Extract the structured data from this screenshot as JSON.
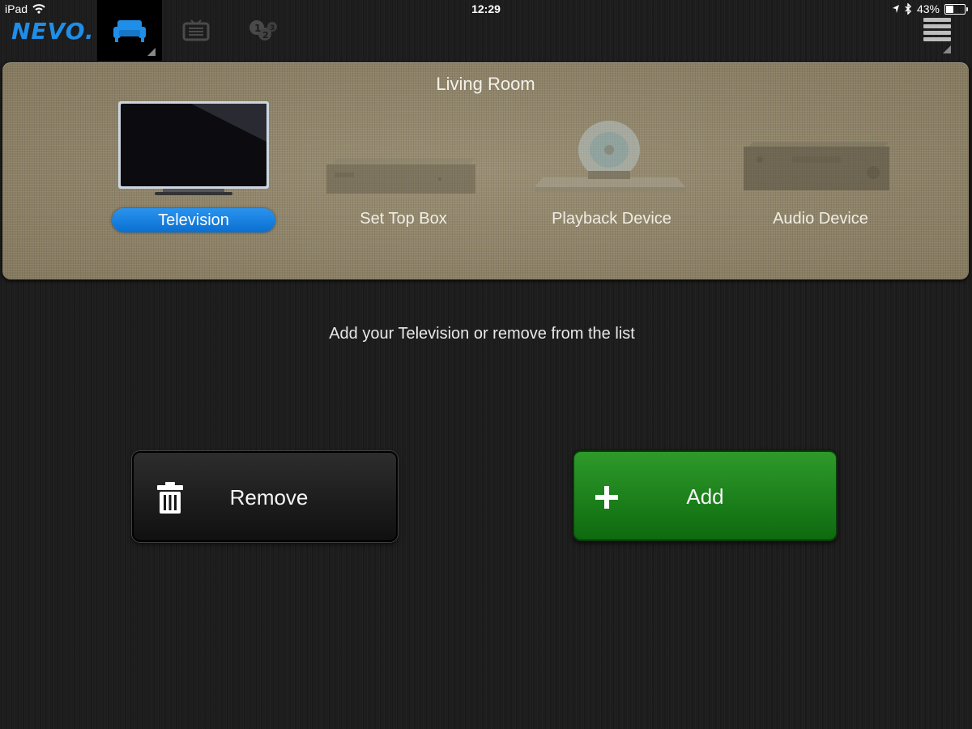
{
  "status_bar": {
    "device": "iPad",
    "time": "12:29",
    "battery": "43%",
    "battery_level": 0.43
  },
  "nav": {
    "logo": "NEVO.",
    "tabs": [
      {
        "icon": "sofa-icon",
        "active": true
      },
      {
        "icon": "tv-guide-icon",
        "active": false
      },
      {
        "icon": "numbers-icon",
        "active": false
      }
    ],
    "menu_icon": "hamburger-menu-icon"
  },
  "room": {
    "title": "Living Room",
    "devices": [
      {
        "label": "Television",
        "icon": "television-icon",
        "selected": true
      },
      {
        "label": "Set Top Box",
        "icon": "set-top-box-icon",
        "selected": false
      },
      {
        "label": "Playback Device",
        "icon": "playback-device-icon",
        "selected": false
      },
      {
        "label": "Audio Device",
        "icon": "audio-device-icon",
        "selected": false
      }
    ]
  },
  "instruction": "Add your Television or remove from the list",
  "actions": {
    "remove_label": "Remove",
    "add_label": "Add"
  },
  "colors": {
    "accent_blue": "#1e8ee9",
    "add_green": "#1f8a1f",
    "panel_beige": "#8f8468"
  }
}
